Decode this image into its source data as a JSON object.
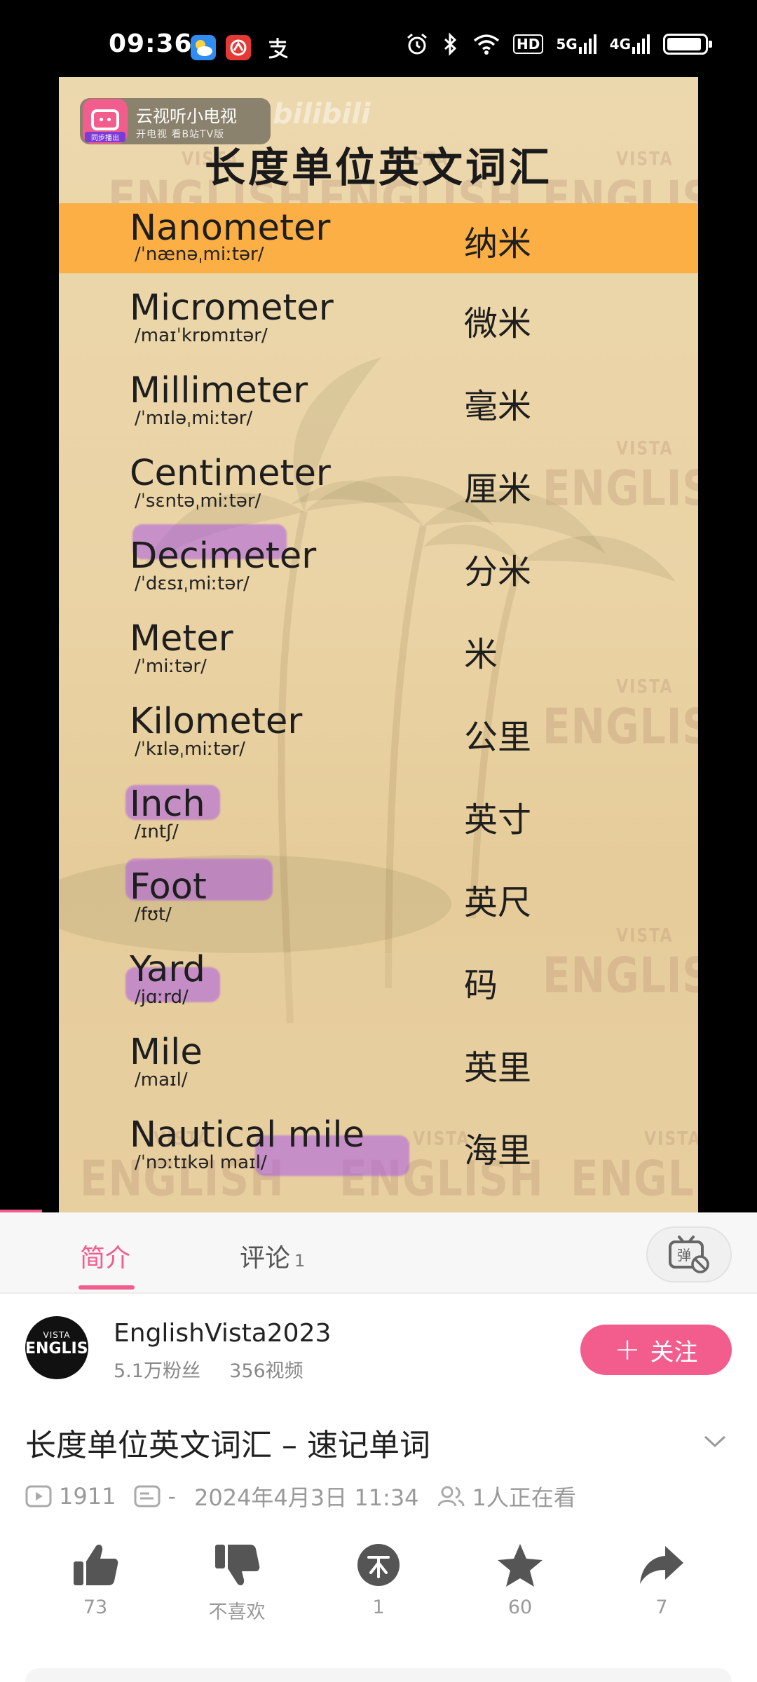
{
  "status_bar": {
    "time": "09:36",
    "network_hd": "HD",
    "network_5g": "5G",
    "network_4g": "4G",
    "icons": [
      "weather-icon",
      "china-mobile-icon",
      "alipay-icon",
      "alarm-icon",
      "bluetooth-icon",
      "wifi-icon",
      "battery-icon"
    ]
  },
  "video": {
    "cast_badge": {
      "title": "云视听小电视",
      "subtitle": "开电视 看B站TV版",
      "sync_label": "同步播出"
    },
    "bilibili_watermark": "bilibili",
    "heading": "长度单位英文词汇",
    "watermark_text": "ENGLISH",
    "watermark_small": "VISTA",
    "rows": [
      {
        "word": "Nanometer",
        "ipa": "/ˈnænəˌmiːtər/",
        "zh": "纳米",
        "highlighted": true
      },
      {
        "word": "Micrometer",
        "ipa": "/maɪˈkrɒmɪtər/",
        "zh": "微米"
      },
      {
        "word": "Millimeter",
        "ipa": "/ˈmɪləˌmiːtər/",
        "zh": "毫米"
      },
      {
        "word": "Centimeter",
        "ipa": "/ˈsɛntəˌmiːtər/",
        "zh": "厘米"
      },
      {
        "word": "Decimeter",
        "ipa": "/ˈdɛsɪˌmiːtər/",
        "zh": "分米"
      },
      {
        "word": "Meter",
        "ipa": "/ˈmiːtər/",
        "zh": "米"
      },
      {
        "word": "Kilometer",
        "ipa": "/ˈkɪləˌmiːtər/",
        "zh": "公里"
      },
      {
        "word": "Inch",
        "ipa": "/ɪntʃ/",
        "zh": "英寸"
      },
      {
        "word": "Foot",
        "ipa": "/fʊt/",
        "zh": "英尺"
      },
      {
        "word": "Yard",
        "ipa": "/jɑːrd/",
        "zh": "码"
      },
      {
        "word": "Mile",
        "ipa": "/maɪl/",
        "zh": "英里"
      },
      {
        "word": "Nautical mile",
        "ipa": "/ˈnɔːtɪkəl maɪl/",
        "zh": "海里"
      }
    ]
  },
  "tabs": {
    "intro": "简介",
    "comments": "评论",
    "comments_count": "1",
    "danmaku_icon": "danmaku-off-icon"
  },
  "uploader": {
    "name": "EnglishVista2023",
    "followers": "5.1万粉丝",
    "videos": "356视频",
    "avatar_top": "VISTA",
    "avatar_main": "ENGLISH",
    "follow_label": "关注"
  },
  "video_info": {
    "title": "长度单位英文词汇 – 速记单词",
    "views": "1911",
    "danmaku": "-",
    "date": "2024年4月3日 11:34",
    "watching": "1人正在看"
  },
  "actions": {
    "like": "73",
    "dislike": "不喜欢",
    "coin": "1",
    "favorite": "60",
    "share": "7"
  },
  "colors": {
    "accent": "#f25d8e",
    "highlight_row": "#fbaf45",
    "marker": "#aa5ae6"
  }
}
